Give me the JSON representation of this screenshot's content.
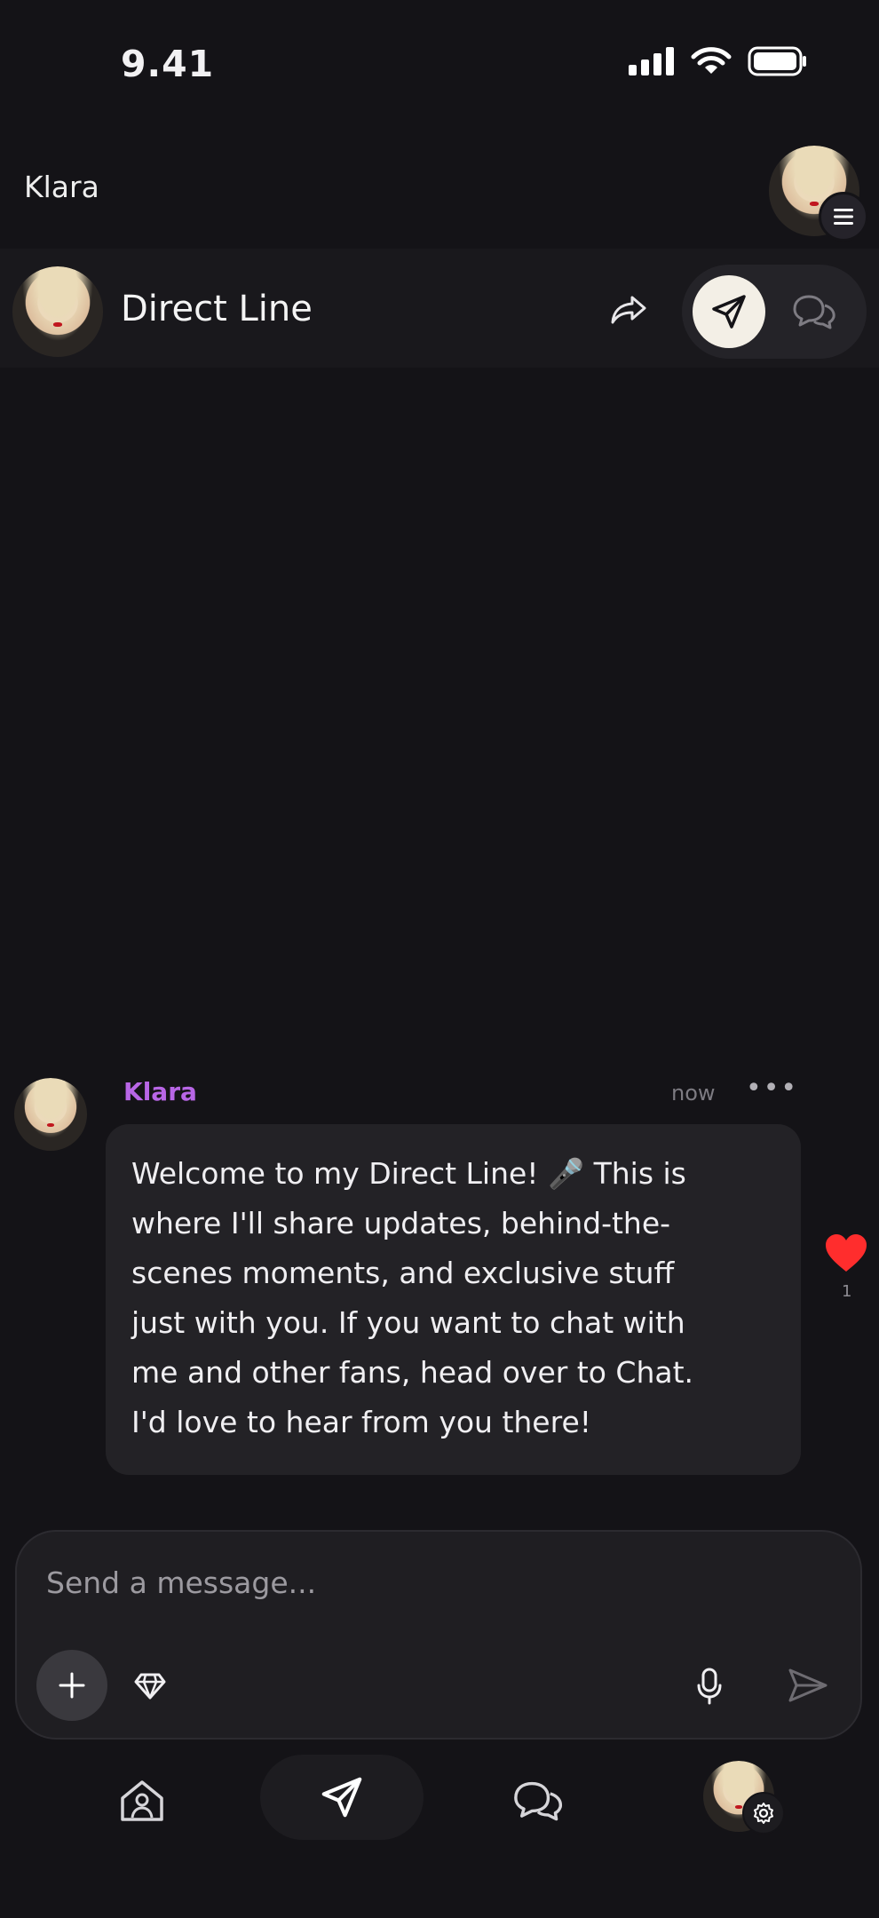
{
  "status_bar": {
    "time": "9.41"
  },
  "header": {
    "creator_name": "Klara"
  },
  "channel": {
    "title": "Direct Line"
  },
  "message": {
    "sender": "Klara",
    "time": "now",
    "text": "Welcome to my Direct Line! 🎤 This is\nwhere I'll share updates, behind-the-\nscenes moments, and exclusive stuff\njust with you. If you want to chat with\nme and other fans, head over to Chat.\nI'd love to hear from you there!",
    "reaction_count": "1",
    "reaction_icon": "heart-icon"
  },
  "composer": {
    "placeholder": "Send a message..."
  },
  "colors": {
    "background": "#141317",
    "accent_name": "#b866e6",
    "heart": "#ff2d2d",
    "active_toggle": "#f3efe6"
  }
}
